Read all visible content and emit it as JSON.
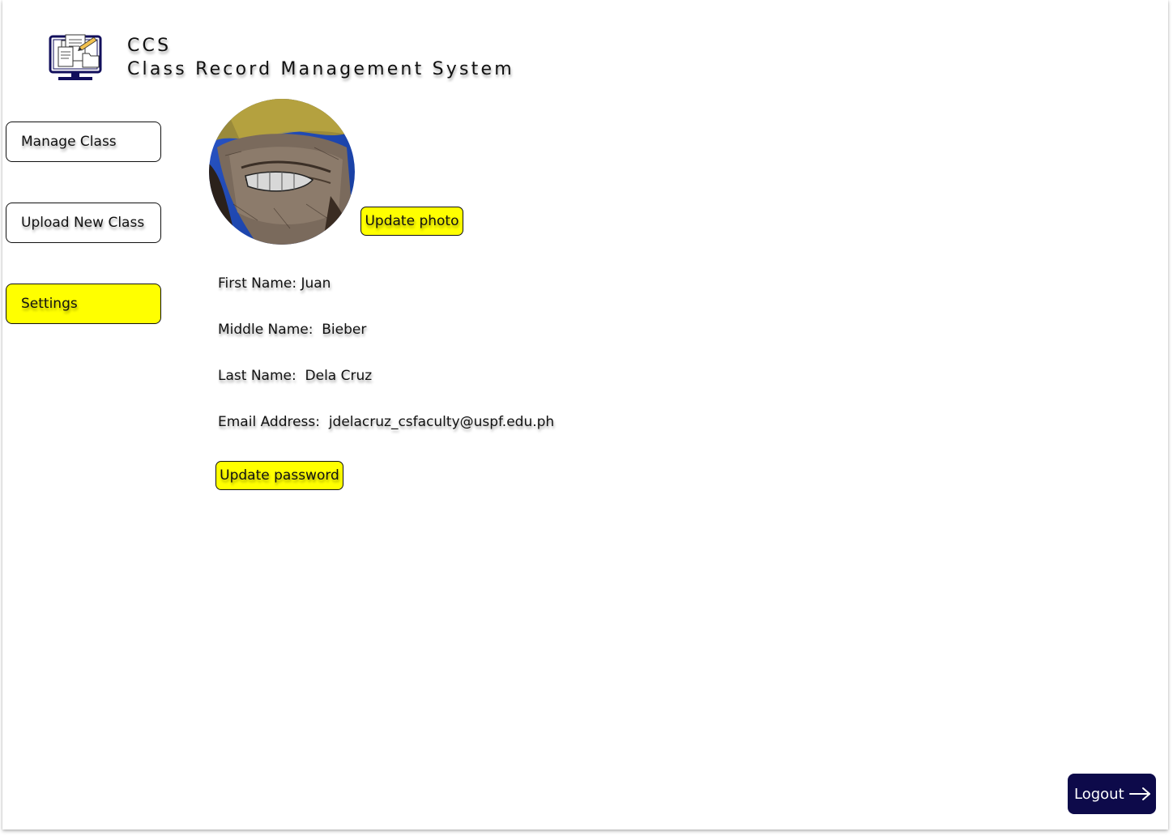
{
  "header": {
    "org": "CCS",
    "title": "Class Record Management System",
    "logo_icon": "computer-monitor-icon"
  },
  "sidebar": {
    "items": [
      {
        "label": "Manage Class",
        "active": false
      },
      {
        "label": "Upload New Class",
        "active": false
      },
      {
        "label": "Settings",
        "active": true
      }
    ]
  },
  "profile": {
    "update_photo_label": "Update photo",
    "fields": [
      {
        "label": "First Name:",
        "value": "Juan"
      },
      {
        "label": "Middle Name:",
        "value": "Bieber"
      },
      {
        "label": "Last Name:",
        "value": "Dela Cruz"
      },
      {
        "label": "Email Address:",
        "value": "jdelacruz_csfaculty@uspf.edu.ph"
      }
    ],
    "update_password_label": "Update password"
  },
  "logout": {
    "label": "Logout",
    "icon": "arrow-right-icon"
  },
  "colors": {
    "accent_yellow": "#ffff00",
    "logout_bg": "#0d0a4a",
    "logo_navy": "#120f5c"
  }
}
